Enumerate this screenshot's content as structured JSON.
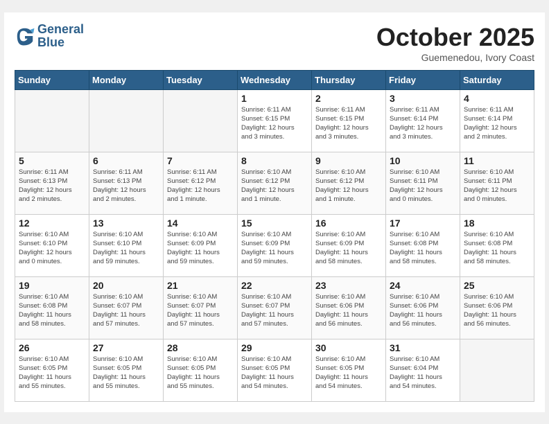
{
  "header": {
    "logo_line1": "General",
    "logo_line2": "Blue",
    "month": "October 2025",
    "location": "Guemenedou, Ivory Coast"
  },
  "days_of_week": [
    "Sunday",
    "Monday",
    "Tuesday",
    "Wednesday",
    "Thursday",
    "Friday",
    "Saturday"
  ],
  "weeks": [
    [
      {
        "day": "",
        "info": ""
      },
      {
        "day": "",
        "info": ""
      },
      {
        "day": "",
        "info": ""
      },
      {
        "day": "1",
        "info": "Sunrise: 6:11 AM\nSunset: 6:15 PM\nDaylight: 12 hours\nand 3 minutes."
      },
      {
        "day": "2",
        "info": "Sunrise: 6:11 AM\nSunset: 6:15 PM\nDaylight: 12 hours\nand 3 minutes."
      },
      {
        "day": "3",
        "info": "Sunrise: 6:11 AM\nSunset: 6:14 PM\nDaylight: 12 hours\nand 3 minutes."
      },
      {
        "day": "4",
        "info": "Sunrise: 6:11 AM\nSunset: 6:14 PM\nDaylight: 12 hours\nand 2 minutes."
      }
    ],
    [
      {
        "day": "5",
        "info": "Sunrise: 6:11 AM\nSunset: 6:13 PM\nDaylight: 12 hours\nand 2 minutes."
      },
      {
        "day": "6",
        "info": "Sunrise: 6:11 AM\nSunset: 6:13 PM\nDaylight: 12 hours\nand 2 minutes."
      },
      {
        "day": "7",
        "info": "Sunrise: 6:11 AM\nSunset: 6:12 PM\nDaylight: 12 hours\nand 1 minute."
      },
      {
        "day": "8",
        "info": "Sunrise: 6:10 AM\nSunset: 6:12 PM\nDaylight: 12 hours\nand 1 minute."
      },
      {
        "day": "9",
        "info": "Sunrise: 6:10 AM\nSunset: 6:12 PM\nDaylight: 12 hours\nand 1 minute."
      },
      {
        "day": "10",
        "info": "Sunrise: 6:10 AM\nSunset: 6:11 PM\nDaylight: 12 hours\nand 0 minutes."
      },
      {
        "day": "11",
        "info": "Sunrise: 6:10 AM\nSunset: 6:11 PM\nDaylight: 12 hours\nand 0 minutes."
      }
    ],
    [
      {
        "day": "12",
        "info": "Sunrise: 6:10 AM\nSunset: 6:10 PM\nDaylight: 12 hours\nand 0 minutes."
      },
      {
        "day": "13",
        "info": "Sunrise: 6:10 AM\nSunset: 6:10 PM\nDaylight: 11 hours\nand 59 minutes."
      },
      {
        "day": "14",
        "info": "Sunrise: 6:10 AM\nSunset: 6:09 PM\nDaylight: 11 hours\nand 59 minutes."
      },
      {
        "day": "15",
        "info": "Sunrise: 6:10 AM\nSunset: 6:09 PM\nDaylight: 11 hours\nand 59 minutes."
      },
      {
        "day": "16",
        "info": "Sunrise: 6:10 AM\nSunset: 6:09 PM\nDaylight: 11 hours\nand 58 minutes."
      },
      {
        "day": "17",
        "info": "Sunrise: 6:10 AM\nSunset: 6:08 PM\nDaylight: 11 hours\nand 58 minutes."
      },
      {
        "day": "18",
        "info": "Sunrise: 6:10 AM\nSunset: 6:08 PM\nDaylight: 11 hours\nand 58 minutes."
      }
    ],
    [
      {
        "day": "19",
        "info": "Sunrise: 6:10 AM\nSunset: 6:08 PM\nDaylight: 11 hours\nand 58 minutes."
      },
      {
        "day": "20",
        "info": "Sunrise: 6:10 AM\nSunset: 6:07 PM\nDaylight: 11 hours\nand 57 minutes."
      },
      {
        "day": "21",
        "info": "Sunrise: 6:10 AM\nSunset: 6:07 PM\nDaylight: 11 hours\nand 57 minutes."
      },
      {
        "day": "22",
        "info": "Sunrise: 6:10 AM\nSunset: 6:07 PM\nDaylight: 11 hours\nand 57 minutes."
      },
      {
        "day": "23",
        "info": "Sunrise: 6:10 AM\nSunset: 6:06 PM\nDaylight: 11 hours\nand 56 minutes."
      },
      {
        "day": "24",
        "info": "Sunrise: 6:10 AM\nSunset: 6:06 PM\nDaylight: 11 hours\nand 56 minutes."
      },
      {
        "day": "25",
        "info": "Sunrise: 6:10 AM\nSunset: 6:06 PM\nDaylight: 11 hours\nand 56 minutes."
      }
    ],
    [
      {
        "day": "26",
        "info": "Sunrise: 6:10 AM\nSunset: 6:05 PM\nDaylight: 11 hours\nand 55 minutes."
      },
      {
        "day": "27",
        "info": "Sunrise: 6:10 AM\nSunset: 6:05 PM\nDaylight: 11 hours\nand 55 minutes."
      },
      {
        "day": "28",
        "info": "Sunrise: 6:10 AM\nSunset: 6:05 PM\nDaylight: 11 hours\nand 55 minutes."
      },
      {
        "day": "29",
        "info": "Sunrise: 6:10 AM\nSunset: 6:05 PM\nDaylight: 11 hours\nand 54 minutes."
      },
      {
        "day": "30",
        "info": "Sunrise: 6:10 AM\nSunset: 6:05 PM\nDaylight: 11 hours\nand 54 minutes."
      },
      {
        "day": "31",
        "info": "Sunrise: 6:10 AM\nSunset: 6:04 PM\nDaylight: 11 hours\nand 54 minutes."
      },
      {
        "day": "",
        "info": ""
      }
    ]
  ]
}
